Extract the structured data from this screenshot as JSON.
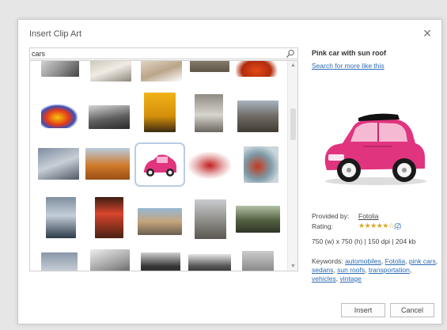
{
  "dialog": {
    "title": "Insert Clip Art"
  },
  "search": {
    "value": "cars",
    "icon": "search-icon"
  },
  "preview": {
    "title": "Pink car with sun roof",
    "more_link": "Search for more like this",
    "provided_by_label": "Provided by:",
    "provider": "Fotolia",
    "rating_label": "Rating:",
    "rating_stars": "★★★★★☆",
    "rating_count": "(2)",
    "rating_value": 5,
    "details": "750 (w) x 750 (h) | 150 dpi | 204 kb",
    "keywords_label": "Keywords:",
    "keywords": [
      "automobiles",
      "Fotolia",
      "pink cars",
      "sedans",
      "sun roofs",
      "transportation",
      "vehicles",
      "vintage"
    ],
    "icons": [
      "pink-car-image"
    ]
  },
  "buttons": {
    "insert": "Insert",
    "cancel": "Cancel"
  },
  "colors": {
    "accent_link": "#2a6bb5",
    "selection": "#b9cce4",
    "star": "#d9a81e",
    "car_pink": "#e0347e"
  }
}
